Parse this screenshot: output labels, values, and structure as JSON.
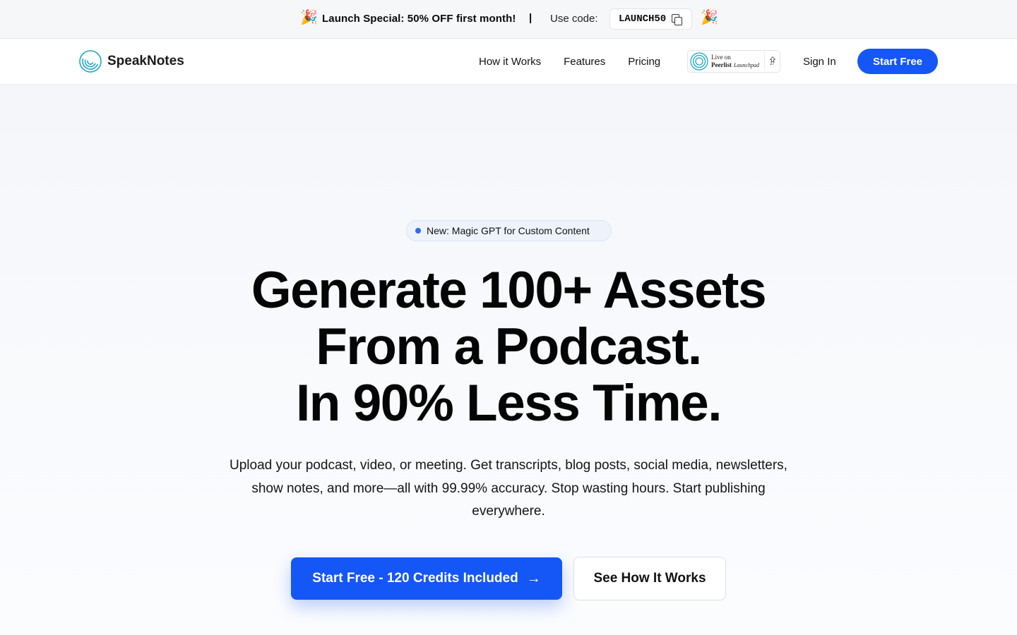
{
  "announcement": {
    "emoji_left": "🎉",
    "emoji_right": "🎉",
    "promo": "Launch Special: 50% OFF first month!",
    "separator": "|",
    "use_code_label": "Use code:",
    "code": "LAUNCH50"
  },
  "nav": {
    "brand": "SpeakNotes",
    "links": [
      "How it Works",
      "Features",
      "Pricing"
    ],
    "peerlist": {
      "line1": "Live on",
      "name": "Peerlist",
      "suffix": "Launchpad",
      "votes": "27"
    },
    "signin": "Sign In",
    "start": "Start Free"
  },
  "hero": {
    "pill": "New: Magic GPT for Custom Content",
    "headline": [
      "Generate 100+ Assets",
      "From a Podcast.",
      "In 90% Less Time."
    ],
    "subtitle": "Upload your podcast, video, or meeting. Get transcripts, blog posts, social media, newsletters, show notes, and more—all with 99.99% accuracy. Stop wasting hours. Start publishing everywhere.",
    "cta_primary": "Start Free - 120 Credits Included",
    "cta_secondary": "See How It Works"
  },
  "colors": {
    "accent": "#1556f6",
    "pill_dot": "#2f6bf0"
  },
  "icons": {
    "copy": "copy-icon",
    "arrow": "arrow-right-icon",
    "logo": "speaknotes-logo-icon"
  }
}
